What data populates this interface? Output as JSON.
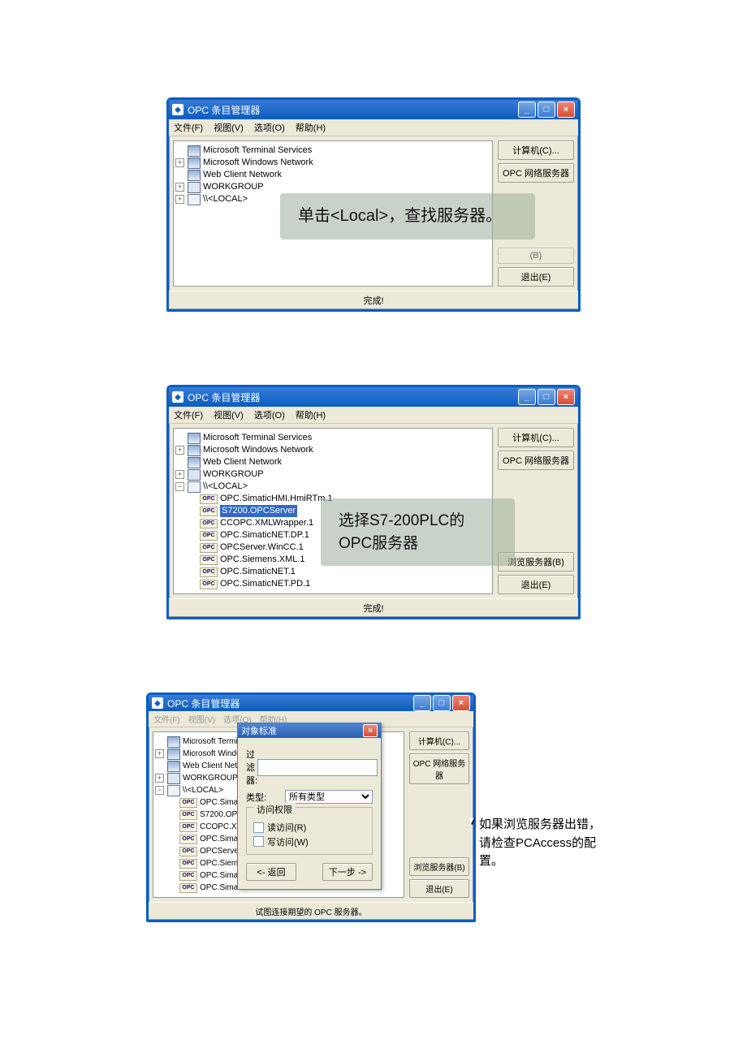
{
  "window_title": "OPC 条目管理器",
  "menu": {
    "file": "文件(F)",
    "view": "视图(V)",
    "options": "选项(O)",
    "help": "帮助(H)"
  },
  "buttons": {
    "computer": "计算机(C)...",
    "opc_web": "OPC 网络服务器",
    "browse": "浏览服务器(B)",
    "exit": "退出(E)"
  },
  "status_done": "完成!",
  "tree_basic": {
    "n0": "Microsoft Terminal Services",
    "n1": "Microsoft Windows Network",
    "n2": "Web Client Network",
    "n3": "WORKGROUP",
    "n4": "\\\\<LOCAL>"
  },
  "opc_nodes": {
    "o0": "OPC.SimaticHMI.HmiRTm.1",
    "o1": "S7200.OPCServer",
    "o2": "CCOPC.XMLWrapper.1",
    "o3": "OPC.SimaticNET.DP.1",
    "o4": "OPCServer.WinCC.1",
    "o5": "OPC.Siemens.XML.1",
    "o6": "OPC.SimaticNET.1",
    "o7": "OPC.SimaticNET.PD.1"
  },
  "opc_nodes_short": {
    "n0": "Microsoft Terminal Ser",
    "n1": "Microsoft Windows Ne",
    "n2": "Web Client Network",
    "n3": "WORKGROUP",
    "n4": "\\\\<LOCAL>",
    "o0": "OPC.SimaticHMI.I",
    "o1": "S7200.OPCServe",
    "o2": "CCOPC.XMLWrap",
    "o3": "OPC.SimaticNET.",
    "o4": "OPCServer.WinCC",
    "o5": "OPC.Siemens.XM",
    "o6": "OPC.SimaticNET.",
    "o7": "OPC.SimaticNET."
  },
  "callout1": "单击<Local>，查找服务器。",
  "callout2": "选择S7-200PLC的OPC服务器",
  "dialog": {
    "title": "对象标准",
    "filter_label": "过滤器:",
    "type_label": "类型:",
    "type_value": "所有类型",
    "access_group": "访问权限",
    "read": "读访问(R)",
    "write": "写访问(W)",
    "back": "<- 返回",
    "next": "下一步 ->"
  },
  "status_trying": "试图连接期望的 OPC 服务器。",
  "annot3": "如果浏览服务器出错，请检查PCAccess的配置。"
}
